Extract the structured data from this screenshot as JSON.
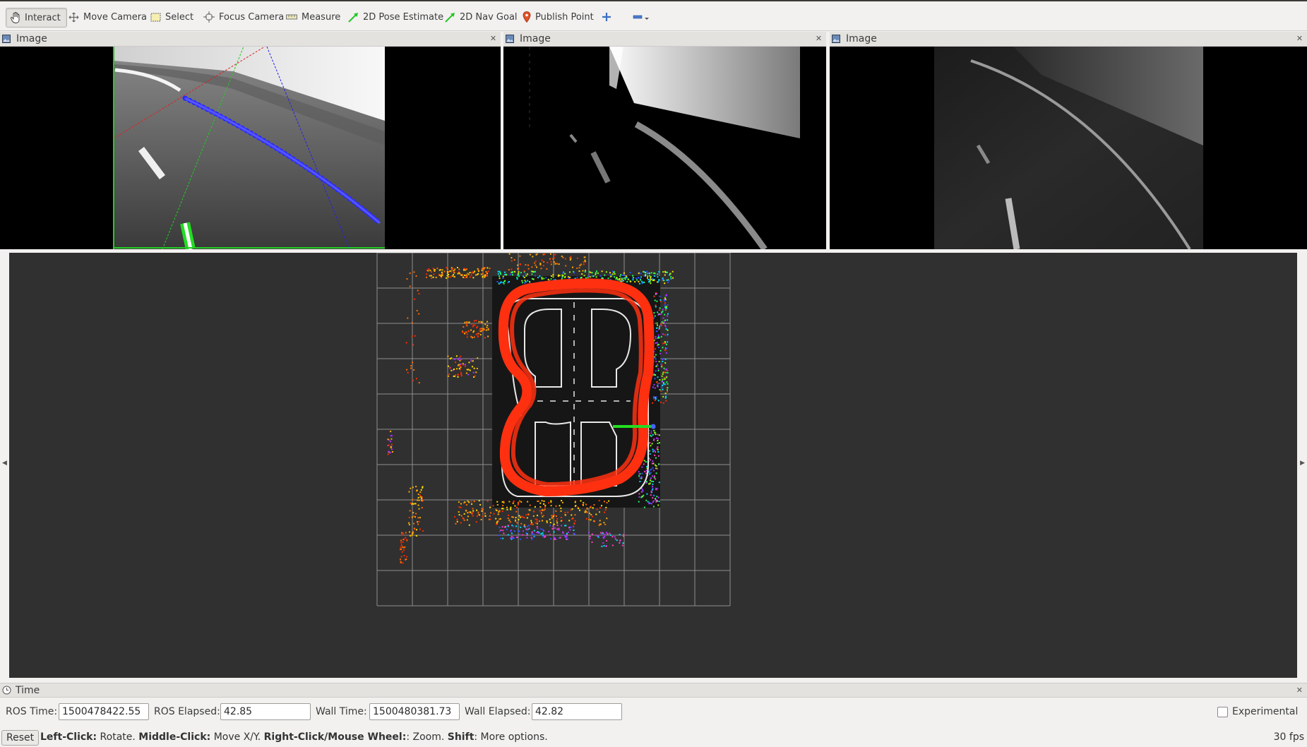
{
  "toolbar": {
    "tools": [
      {
        "label": "Interact",
        "icon": "hand-icon"
      },
      {
        "label": "Move Camera",
        "icon": "move-camera-icon"
      },
      {
        "label": "Select",
        "icon": "select-icon"
      },
      {
        "label": "Focus Camera",
        "icon": "focus-camera-icon"
      },
      {
        "label": "Measure",
        "icon": "measure-icon"
      },
      {
        "label": "2D Pose Estimate",
        "icon": "pose-estimate-arrow-icon"
      },
      {
        "label": "2D Nav Goal",
        "icon": "nav-goal-arrow-icon"
      },
      {
        "label": "Publish Point",
        "icon": "map-pin-icon"
      }
    ],
    "add_icon": "plus-icon",
    "remove_icon": "minus-icon"
  },
  "panels": [
    {
      "title": "Image"
    },
    {
      "title": "Image"
    },
    {
      "title": "Image"
    }
  ],
  "time": {
    "title": "Time",
    "ros_time_label": "ROS Time:",
    "ros_time": "1500478422.55",
    "ros_elapsed_label": "ROS Elapsed:",
    "ros_elapsed": "42.85",
    "wall_time_label": "Wall Time:",
    "wall_time": "1500480381.73",
    "wall_elapsed_label": "Wall Elapsed:",
    "wall_elapsed": "42.82",
    "experimental_label": "Experimental"
  },
  "status": {
    "reset_label": "Reset",
    "help": [
      {
        "key": "Left-Click:",
        "text": " Rotate. "
      },
      {
        "key": "Middle-Click:",
        "text": " Move X/Y. "
      },
      {
        "key": "Right-Click/Mouse Wheel:",
        "text": ": Zoom. "
      },
      {
        "key": "Shift",
        "text": ": More options."
      }
    ],
    "fps": "30 fps"
  },
  "colors": {
    "track_path": "#ff3010",
    "pose_arrow": "#22dd22",
    "lane_points": "#2a2aff",
    "viewport_bg": "#303030",
    "grid": "#9a9a9a"
  }
}
